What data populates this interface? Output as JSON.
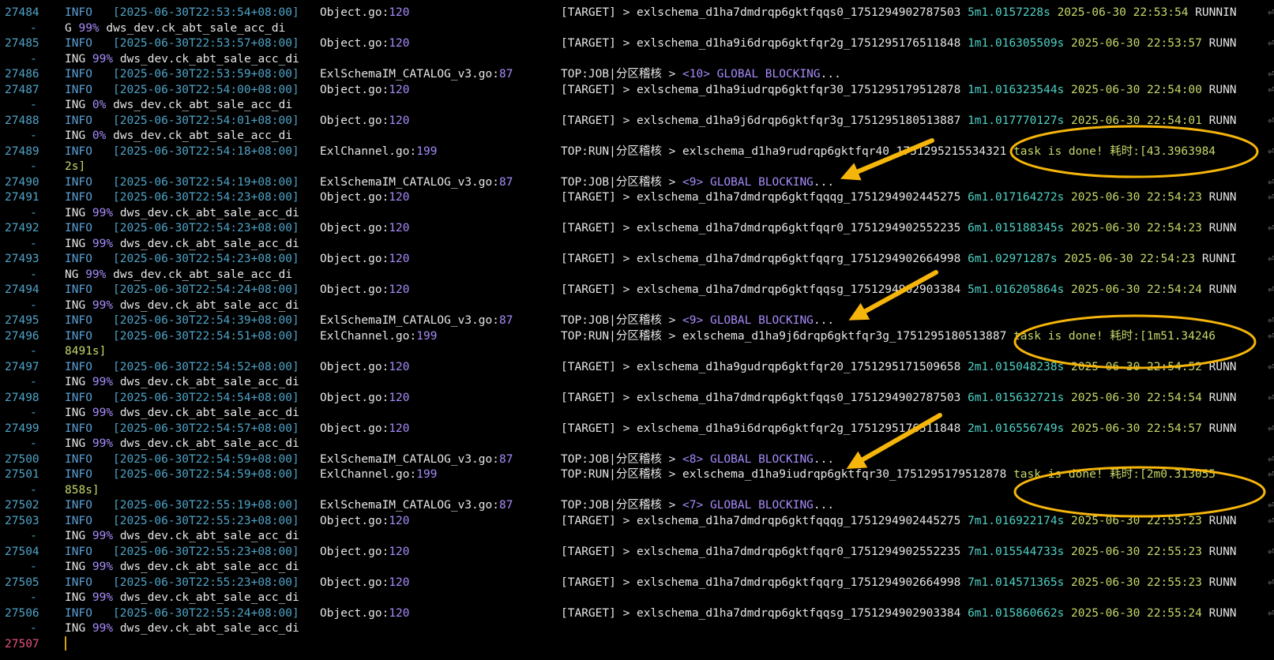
{
  "terminal": {
    "accent_color": "#f5b50a",
    "rows": [
      {
        "kind": "entry",
        "ln": "27484",
        "level": "INFO",
        "ts": "2025-06-30T22:53:54+08:00",
        "file": "Object.go",
        "fline": "120",
        "parts": [
          {
            "t": "[TARGET] > exlschema_d1ha7dmdrqp6gktfqqs0_1751294902787503 ",
            "c": ""
          },
          {
            "t": "5m1.0157228s",
            "c": "dur"
          },
          {
            "t": " ",
            "c": ""
          },
          {
            "t": "2025-06-30 22:53:54",
            "c": "dt"
          },
          {
            "t": " RUNNIN",
            "c": ""
          }
        ]
      },
      {
        "kind": "wrap",
        "parts": [
          {
            "t": "G ",
            "c": ""
          },
          {
            "t": "99%",
            "c": "pct"
          },
          {
            "t": " dws_dev.ck_abt_sale_acc_di",
            "c": ""
          }
        ]
      },
      {
        "kind": "entry",
        "ln": "27485",
        "level": "INFO",
        "ts": "2025-06-30T22:53:57+08:00",
        "file": "Object.go",
        "fline": "120",
        "parts": [
          {
            "t": "[TARGET] > exlschema_d1ha9i6drqp6gktfqr2g_1751295176511848 ",
            "c": ""
          },
          {
            "t": "1m1.016305509s",
            "c": "dur"
          },
          {
            "t": " ",
            "c": ""
          },
          {
            "t": "2025-06-30 22:53:57",
            "c": "dt"
          },
          {
            "t": " RUNN",
            "c": ""
          }
        ]
      },
      {
        "kind": "wrap",
        "parts": [
          {
            "t": "ING ",
            "c": ""
          },
          {
            "t": "99%",
            "c": "pct"
          },
          {
            "t": " dws_dev.ck_abt_sale_acc_di",
            "c": ""
          }
        ]
      },
      {
        "kind": "entry",
        "ln": "27486",
        "level": "INFO",
        "ts": "2025-06-30T22:53:59+08:00",
        "file": "ExlSchemaIM_CATALOG_v3.go",
        "fline": "87",
        "parts": [
          {
            "t": "TOP:JOB|分区稽核 > ",
            "c": ""
          },
          {
            "t": "<10>",
            "c": "num"
          },
          {
            "t": " GLOBAL BLOCKING",
            "c": "glob"
          },
          {
            "t": "...",
            "c": ""
          }
        ]
      },
      {
        "kind": "entry",
        "ln": "27487",
        "level": "INFO",
        "ts": "2025-06-30T22:54:00+08:00",
        "file": "Object.go",
        "fline": "120",
        "parts": [
          {
            "t": "[TARGET] > exlschema_d1ha9iudrqp6gktfqr30_1751295179512878 ",
            "c": ""
          },
          {
            "t": "1m1.016323544s",
            "c": "dur"
          },
          {
            "t": " ",
            "c": ""
          },
          {
            "t": "2025-06-30 22:54:00",
            "c": "dt"
          },
          {
            "t": " RUNN",
            "c": ""
          }
        ]
      },
      {
        "kind": "wrap",
        "parts": [
          {
            "t": "ING ",
            "c": ""
          },
          {
            "t": "0%",
            "c": "pct"
          },
          {
            "t": " dws_dev.ck_abt_sale_acc_di",
            "c": ""
          }
        ]
      },
      {
        "kind": "entry",
        "ln": "27488",
        "level": "INFO",
        "ts": "2025-06-30T22:54:01+08:00",
        "file": "Object.go",
        "fline": "120",
        "parts": [
          {
            "t": "[TARGET] > exlschema_d1ha9j6drqp6gktfqr3g_1751295180513887 ",
            "c": ""
          },
          {
            "t": "1m1.017770127s",
            "c": "dur"
          },
          {
            "t": " ",
            "c": ""
          },
          {
            "t": "2025-06-30 22:54:01",
            "c": "dt"
          },
          {
            "t": " RUNN",
            "c": ""
          }
        ]
      },
      {
        "kind": "wrap",
        "parts": [
          {
            "t": "ING ",
            "c": ""
          },
          {
            "t": "0%",
            "c": "pct"
          },
          {
            "t": " dws_dev.ck_abt_sale_acc_di",
            "c": ""
          }
        ]
      },
      {
        "kind": "entry",
        "ln": "27489",
        "level": "INFO",
        "ts": "2025-06-30T22:54:18+08:00",
        "file": "ExlChannel.go",
        "fline": "199",
        "parts": [
          {
            "t": "TOP:RUN|分区稽核 > exlschema_d1ha9rudrqp6gktfqr40_1751295215534321 ",
            "c": ""
          },
          {
            "t": "task is done! 耗时:[43.3963984",
            "c": "done"
          }
        ]
      },
      {
        "kind": "wrap",
        "parts": [
          {
            "t": "2s]",
            "c": "done"
          }
        ]
      },
      {
        "kind": "entry",
        "ln": "27490",
        "level": "INFO",
        "ts": "2025-06-30T22:54:19+08:00",
        "file": "ExlSchemaIM_CATALOG_v3.go",
        "fline": "87",
        "parts": [
          {
            "t": "TOP:JOB|分区稽核 > ",
            "c": ""
          },
          {
            "t": "<9>",
            "c": "num"
          },
          {
            "t": " GLOBAL BLOCKING",
            "c": "glob"
          },
          {
            "t": "...",
            "c": ""
          }
        ]
      },
      {
        "kind": "entry",
        "ln": "27491",
        "level": "INFO",
        "ts": "2025-06-30T22:54:23+08:00",
        "file": "Object.go",
        "fline": "120",
        "parts": [
          {
            "t": "[TARGET] > exlschema_d1ha7dmdrqp6gktfqqqg_1751294902445275 ",
            "c": ""
          },
          {
            "t": "6m1.017164272s",
            "c": "dur"
          },
          {
            "t": " ",
            "c": ""
          },
          {
            "t": "2025-06-30 22:54:23",
            "c": "dt"
          },
          {
            "t": " RUNN",
            "c": ""
          }
        ]
      },
      {
        "kind": "wrap",
        "parts": [
          {
            "t": "ING ",
            "c": ""
          },
          {
            "t": "99%",
            "c": "pct"
          },
          {
            "t": " dws_dev.ck_abt_sale_acc_di",
            "c": ""
          }
        ]
      },
      {
        "kind": "entry",
        "ln": "27492",
        "level": "INFO",
        "ts": "2025-06-30T22:54:23+08:00",
        "file": "Object.go",
        "fline": "120",
        "parts": [
          {
            "t": "[TARGET] > exlschema_d1ha7dmdrqp6gktfqqr0_1751294902552235 ",
            "c": ""
          },
          {
            "t": "6m1.015188345s",
            "c": "dur"
          },
          {
            "t": " ",
            "c": ""
          },
          {
            "t": "2025-06-30 22:54:23",
            "c": "dt"
          },
          {
            "t": " RUNN",
            "c": ""
          }
        ]
      },
      {
        "kind": "wrap",
        "parts": [
          {
            "t": "ING ",
            "c": ""
          },
          {
            "t": "99%",
            "c": "pct"
          },
          {
            "t": " dws_dev.ck_abt_sale_acc_di",
            "c": ""
          }
        ]
      },
      {
        "kind": "entry",
        "ln": "27493",
        "level": "INFO",
        "ts": "2025-06-30T22:54:23+08:00",
        "file": "Object.go",
        "fline": "120",
        "parts": [
          {
            "t": "[TARGET] > exlschema_d1ha7dmdrqp6gktfqqrg_1751294902664998 ",
            "c": ""
          },
          {
            "t": "6m1.02971287s",
            "c": "dur"
          },
          {
            "t": " ",
            "c": ""
          },
          {
            "t": "2025-06-30 22:54:23",
            "c": "dt"
          },
          {
            "t": " RUNNI",
            "c": ""
          }
        ]
      },
      {
        "kind": "wrap",
        "parts": [
          {
            "t": "NG ",
            "c": ""
          },
          {
            "t": "99%",
            "c": "pct"
          },
          {
            "t": " dws_dev.ck_abt_sale_acc_di",
            "c": ""
          }
        ]
      },
      {
        "kind": "entry",
        "ln": "27494",
        "level": "INFO",
        "ts": "2025-06-30T22:54:24+08:00",
        "file": "Object.go",
        "fline": "120",
        "parts": [
          {
            "t": "[TARGET] > exlschema_d1ha7dmdrqp6gktfqqsg_1751294902903384 ",
            "c": ""
          },
          {
            "t": "5m1.016205864s",
            "c": "dur"
          },
          {
            "t": " ",
            "c": ""
          },
          {
            "t": "2025-06-30 22:54:24",
            "c": "dt"
          },
          {
            "t": " RUNN",
            "c": ""
          }
        ]
      },
      {
        "kind": "wrap",
        "parts": [
          {
            "t": "ING ",
            "c": ""
          },
          {
            "t": "99%",
            "c": "pct"
          },
          {
            "t": " dws_dev.ck_abt_sale_acc_di",
            "c": ""
          }
        ]
      },
      {
        "kind": "entry",
        "ln": "27495",
        "level": "INFO",
        "ts": "2025-06-30T22:54:39+08:00",
        "file": "ExlSchemaIM_CATALOG_v3.go",
        "fline": "87",
        "parts": [
          {
            "t": "TOP:JOB|分区稽核 > ",
            "c": ""
          },
          {
            "t": "<9>",
            "c": "num"
          },
          {
            "t": " GLOBAL BLOCKING",
            "c": "glob"
          },
          {
            "t": "...",
            "c": ""
          }
        ]
      },
      {
        "kind": "entry",
        "ln": "27496",
        "level": "INFO",
        "ts": "2025-06-30T22:54:51+08:00",
        "file": "ExlChannel.go",
        "fline": "199",
        "parts": [
          {
            "t": "TOP:RUN|分区稽核 > exlschema_d1ha9j6drqp6gktfqr3g_1751295180513887 ",
            "c": ""
          },
          {
            "t": "task is done! 耗时:[1m51.34246",
            "c": "done"
          }
        ]
      },
      {
        "kind": "wrap",
        "parts": [
          {
            "t": "8491s]",
            "c": "done"
          }
        ]
      },
      {
        "kind": "entry",
        "ln": "27497",
        "level": "INFO",
        "ts": "2025-06-30T22:54:52+08:00",
        "file": "Object.go",
        "fline": "120",
        "parts": [
          {
            "t": "[TARGET] > exlschema_d1ha9gudrqp6gktfqr20_1751295171509658 ",
            "c": ""
          },
          {
            "t": "2m1.015048238s",
            "c": "dur"
          },
          {
            "t": " ",
            "c": ""
          },
          {
            "t": "2025-06-30 22:54:52",
            "c": "dt"
          },
          {
            "t": " RUNN",
            "c": ""
          }
        ]
      },
      {
        "kind": "wrap",
        "parts": [
          {
            "t": "ING ",
            "c": ""
          },
          {
            "t": "99%",
            "c": "pct"
          },
          {
            "t": " dws_dev.ck_abt_sale_acc_di",
            "c": ""
          }
        ]
      },
      {
        "kind": "entry",
        "ln": "27498",
        "level": "INFO",
        "ts": "2025-06-30T22:54:54+08:00",
        "file": "Object.go",
        "fline": "120",
        "parts": [
          {
            "t": "[TARGET] > exlschema_d1ha7dmdrqp6gktfqqs0_1751294902787503 ",
            "c": ""
          },
          {
            "t": "6m1.015632721s",
            "c": "dur"
          },
          {
            "t": " ",
            "c": ""
          },
          {
            "t": "2025-06-30 22:54:54",
            "c": "dt"
          },
          {
            "t": " RUNN",
            "c": ""
          }
        ]
      },
      {
        "kind": "wrap",
        "parts": [
          {
            "t": "ING ",
            "c": ""
          },
          {
            "t": "99%",
            "c": "pct"
          },
          {
            "t": " dws_dev.ck_abt_sale_acc_di",
            "c": ""
          }
        ]
      },
      {
        "kind": "entry",
        "ln": "27499",
        "level": "INFO",
        "ts": "2025-06-30T22:54:57+08:00",
        "file": "Object.go",
        "fline": "120",
        "parts": [
          {
            "t": "[TARGET] > exlschema_d1ha9i6drqp6gktfqr2g_1751295176511848 ",
            "c": ""
          },
          {
            "t": "2m1.016556749s",
            "c": "dur"
          },
          {
            "t": " ",
            "c": ""
          },
          {
            "t": "2025-06-30 22:54:57",
            "c": "dt"
          },
          {
            "t": " RUNN",
            "c": ""
          }
        ]
      },
      {
        "kind": "wrap",
        "parts": [
          {
            "t": "ING ",
            "c": ""
          },
          {
            "t": "99%",
            "c": "pct"
          },
          {
            "t": " dws_dev.ck_abt_sale_acc_di",
            "c": ""
          }
        ]
      },
      {
        "kind": "entry",
        "ln": "27500",
        "level": "INFO",
        "ts": "2025-06-30T22:54:59+08:00",
        "file": "ExlSchemaIM_CATALOG_v3.go",
        "fline": "87",
        "parts": [
          {
            "t": "TOP:JOB|分区稽核 > ",
            "c": ""
          },
          {
            "t": "<8>",
            "c": "num"
          },
          {
            "t": " GLOBAL BLOCKING",
            "c": "glob"
          },
          {
            "t": "...",
            "c": ""
          }
        ]
      },
      {
        "kind": "entry",
        "ln": "27501",
        "level": "INFO",
        "ts": "2025-06-30T22:54:59+08:00",
        "file": "ExlChannel.go",
        "fline": "199",
        "parts": [
          {
            "t": "TOP:RUN|分区稽核 > exlschema_d1ha9iudrqp6gktfqr30_1751295179512878 ",
            "c": ""
          },
          {
            "t": "task is done! 耗时:[2m0.313055",
            "c": "done"
          }
        ]
      },
      {
        "kind": "wrap",
        "parts": [
          {
            "t": "858s]",
            "c": "done"
          }
        ]
      },
      {
        "kind": "entry",
        "ln": "27502",
        "level": "INFO",
        "ts": "2025-06-30T22:55:19+08:00",
        "file": "ExlSchemaIM_CATALOG_v3.go",
        "fline": "87",
        "parts": [
          {
            "t": "TOP:JOB|分区稽核 > ",
            "c": ""
          },
          {
            "t": "<7>",
            "c": "num"
          },
          {
            "t": " GLOBAL BLOCKING",
            "c": "glob"
          },
          {
            "t": "...",
            "c": ""
          }
        ]
      },
      {
        "kind": "entry",
        "ln": "27503",
        "level": "INFO",
        "ts": "2025-06-30T22:55:23+08:00",
        "file": "Object.go",
        "fline": "120",
        "parts": [
          {
            "t": "[TARGET] > exlschema_d1ha7dmdrqp6gktfqqqg_1751294902445275 ",
            "c": ""
          },
          {
            "t": "7m1.016922174s",
            "c": "dur"
          },
          {
            "t": " ",
            "c": ""
          },
          {
            "t": "2025-06-30 22:55:23",
            "c": "dt"
          },
          {
            "t": " RUNN",
            "c": ""
          }
        ]
      },
      {
        "kind": "wrap",
        "parts": [
          {
            "t": "ING ",
            "c": ""
          },
          {
            "t": "99%",
            "c": "pct"
          },
          {
            "t": " dws_dev.ck_abt_sale_acc_di",
            "c": ""
          }
        ]
      },
      {
        "kind": "entry",
        "ln": "27504",
        "level": "INFO",
        "ts": "2025-06-30T22:55:23+08:00",
        "file": "Object.go",
        "fline": "120",
        "parts": [
          {
            "t": "[TARGET] > exlschema_d1ha7dmdrqp6gktfqqr0_1751294902552235 ",
            "c": ""
          },
          {
            "t": "7m1.015544733s",
            "c": "dur"
          },
          {
            "t": " ",
            "c": ""
          },
          {
            "t": "2025-06-30 22:55:23",
            "c": "dt"
          },
          {
            "t": " RUNN",
            "c": ""
          }
        ]
      },
      {
        "kind": "wrap",
        "parts": [
          {
            "t": "ING ",
            "c": ""
          },
          {
            "t": "99%",
            "c": "pct"
          },
          {
            "t": " dws_dev.ck_abt_sale_acc_di",
            "c": ""
          }
        ]
      },
      {
        "kind": "entry",
        "ln": "27505",
        "level": "INFO",
        "ts": "2025-06-30T22:55:23+08:00",
        "file": "Object.go",
        "fline": "120",
        "parts": [
          {
            "t": "[TARGET] > exlschema_d1ha7dmdrqp6gktfqqrg_1751294902664998 ",
            "c": ""
          },
          {
            "t": "7m1.014571365s",
            "c": "dur"
          },
          {
            "t": " ",
            "c": ""
          },
          {
            "t": "2025-06-30 22:55:23",
            "c": "dt"
          },
          {
            "t": " RUNN",
            "c": ""
          }
        ]
      },
      {
        "kind": "wrap",
        "parts": [
          {
            "t": "ING ",
            "c": ""
          },
          {
            "t": "99%",
            "c": "pct"
          },
          {
            "t": " dws_dev.ck_abt_sale_acc_di",
            "c": ""
          }
        ]
      },
      {
        "kind": "entry",
        "ln": "27506",
        "level": "INFO",
        "ts": "2025-06-30T22:55:24+08:00",
        "file": "Object.go",
        "fline": "120",
        "parts": [
          {
            "t": "[TARGET] > exlschema_d1ha7dmdrqp6gktfqqsg_1751294902903384 ",
            "c": ""
          },
          {
            "t": "6m1.015860662s",
            "c": "dur"
          },
          {
            "t": " ",
            "c": ""
          },
          {
            "t": "2025-06-30 22:55:24",
            "c": "dt"
          },
          {
            "t": " RUNN",
            "c": ""
          }
        ]
      },
      {
        "kind": "wrap",
        "parts": [
          {
            "t": "ING ",
            "c": ""
          },
          {
            "t": "99%",
            "c": "pct"
          },
          {
            "t": " dws_dev.ck_abt_sale_acc_di",
            "c": ""
          }
        ]
      },
      {
        "kind": "cursor",
        "ln": "27507"
      }
    ]
  }
}
